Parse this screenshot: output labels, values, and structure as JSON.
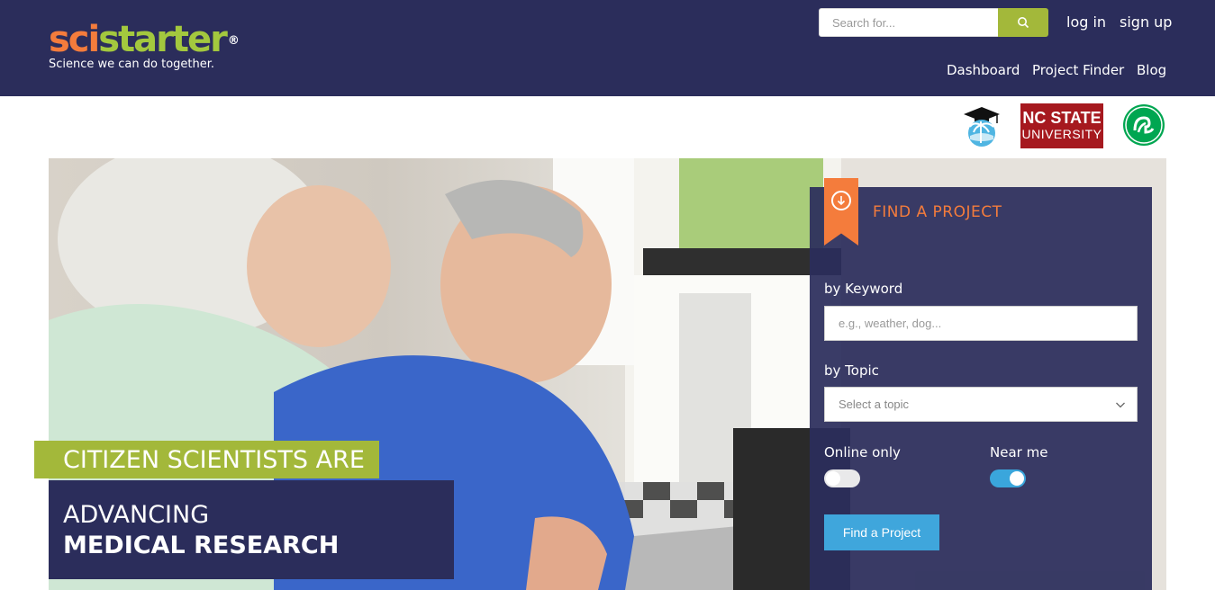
{
  "brand": {
    "logo_part1": "sci",
    "logo_part2": "starter",
    "logo_registered": "®",
    "tagline": "Science we can do together."
  },
  "header": {
    "search_placeholder": "Search for...",
    "search_icon": "search-icon",
    "login_label": "log in",
    "signup_label": "sign up",
    "nav": [
      "Dashboard",
      "Project Finder",
      "Blog"
    ]
  },
  "partners": {
    "ncstate_line1": "NC STATE",
    "ncstate_line2": "UNIVERSITY",
    "items": [
      "graduation-palm-logo",
      "nc-state-university-logo",
      "girl-scouts-logo"
    ]
  },
  "hero": {
    "headline_top": "CITIZEN SCIENTISTS ARE",
    "headline_line1": "ADVANCING",
    "headline_line2": "MEDICAL RESEARCH"
  },
  "finder": {
    "title": "FIND A PROJECT",
    "keyword_label": "by Keyword",
    "keyword_placeholder": "e.g., weather, dog...",
    "topic_label": "by Topic",
    "topic_selected": "Select a topic",
    "online_label": "Online only",
    "online_on": false,
    "near_label": "Near me",
    "near_on": true,
    "button_label": "Find a Project"
  },
  "colors": {
    "header_bg": "#2b2d5b",
    "accent_orange": "#f47c3c",
    "accent_green": "#a3b83a",
    "button_blue": "#3fa6dc"
  }
}
